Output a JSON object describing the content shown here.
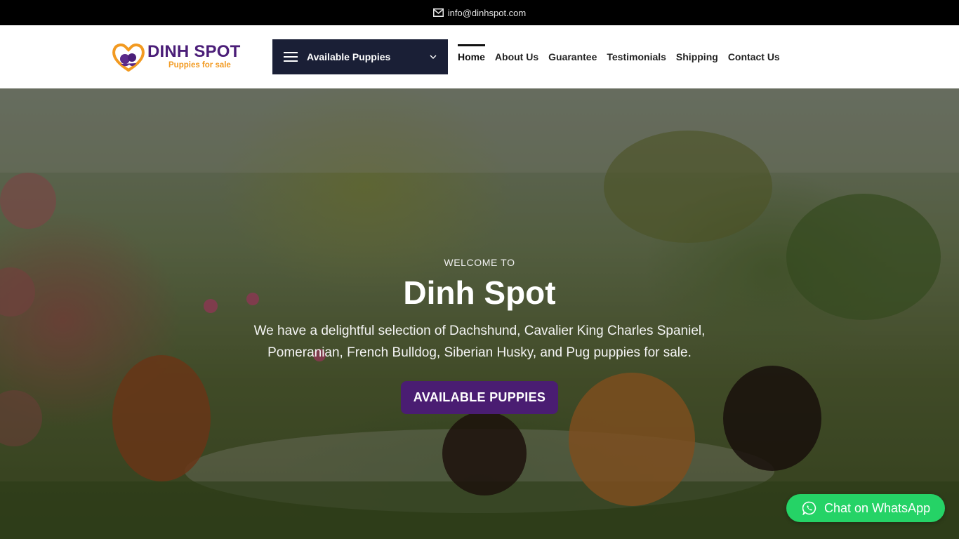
{
  "topbar": {
    "email": "info@dinhspot.com",
    "icon": "envelope-icon"
  },
  "header": {
    "logo": {
      "brand": "DINH SPOT",
      "tagline": "Puppies for sale"
    },
    "category_button": {
      "label": "Available Puppies",
      "icon": "hamburger-icon"
    },
    "nav": [
      {
        "label": "Home",
        "active": true
      },
      {
        "label": "About Us"
      },
      {
        "label": "Guarantee"
      },
      {
        "label": "Testimonials"
      },
      {
        "label": "Shipping"
      },
      {
        "label": "Contact Us"
      }
    ]
  },
  "hero": {
    "eyebrow": "WELCOME TO",
    "title": "Dinh Spot",
    "description": "We have a delightful selection of Dachshund, Cavalier King Charles Spaniel, Pomeranian, French Bulldog, Siberian Husky, and Pug puppies for sale.",
    "button_label": "AVAILABLE PUPPIES"
  },
  "whatsapp": {
    "label": "Chat on WhatsApp",
    "icon": "whatsapp-icon"
  },
  "colors": {
    "brand_purple": "#4a1d72",
    "brand_orange": "#f29a21",
    "nav_dark": "#1a1f36",
    "whatsapp_green": "#25d366"
  }
}
